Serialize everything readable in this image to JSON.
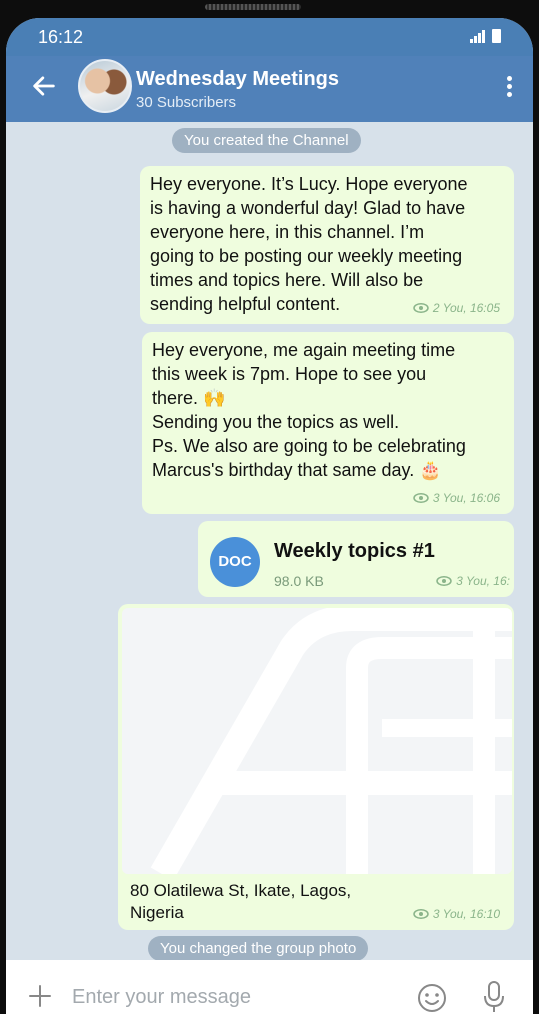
{
  "status": {
    "time": "16:12"
  },
  "header": {
    "title": "Wednesday Meetings",
    "subtitle": "30 Subscribers"
  },
  "service_top": "You created the Channel",
  "messages": [
    {
      "text": "Hey everyone. It’s Lucy. Hope everyone\nis having a wonderful day! Glad to have\neveryone here, in this channel. I’m\ngoing to be posting our weekly meeting\ntimes and topics here. Will also be\nsending helpful content.",
      "meta": "2 You, 16:05"
    },
    {
      "text": "Hey everyone, me again meeting time\nthis week is 7pm. Hope to see you\nthere. 🙌\nSending you the topics as well.\nPs. We also are going to be celebrating\nMarcus's birthday that same day. 🎂",
      "meta": "3 You, 16:06"
    }
  ],
  "document": {
    "icon_label": "DOC",
    "title": "Weekly topics #1",
    "size": "98.0 KB",
    "meta": "3 You, 16:"
  },
  "location": {
    "address": "80 Olatilewa St, Ikate, Lagos,\nNigeria",
    "meta": "3 You, 16:10"
  },
  "service_bottom": "You changed the group photo",
  "input": {
    "placeholder": "Enter your message"
  },
  "colors": {
    "header": "#5081b9",
    "bubble": "#effdde",
    "doc_accent": "#4a90d9"
  },
  "icons": [
    "back-arrow-icon",
    "more-vert-icon",
    "eye-icon",
    "plus-icon",
    "emoji-icon",
    "mic-icon",
    "signal-icon",
    "battery-icon"
  ]
}
